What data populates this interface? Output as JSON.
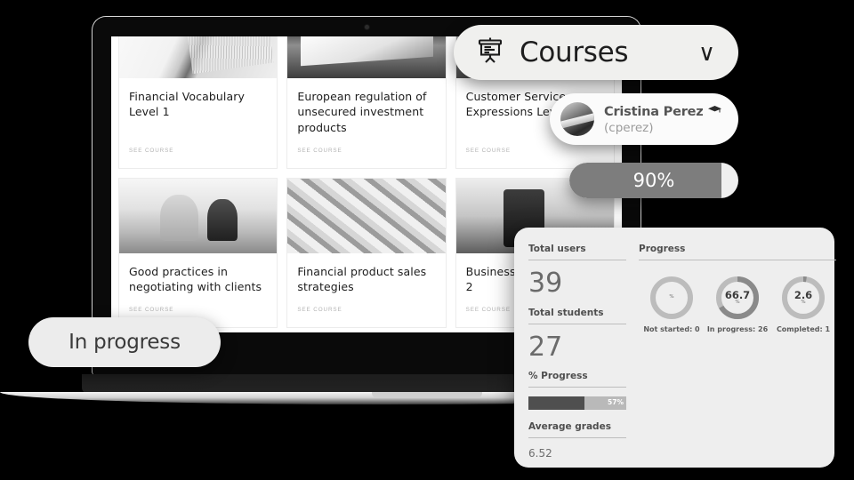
{
  "header": {
    "courses_label": "Courses",
    "chevron": "∨"
  },
  "user": {
    "name": "Cristina Perez",
    "handle": "(cperez)"
  },
  "progress_pill": {
    "value_label": "90%",
    "percent": 90
  },
  "status_pill": {
    "label": "In progress"
  },
  "courses": [
    {
      "title": "Financial Vocabulary Level 1",
      "link": "SEE COURSE",
      "photo": "ph-book"
    },
    {
      "title": "European regulation of unsecured investment products",
      "link": "SEE COURSE",
      "photo": "ph-sign"
    },
    {
      "title": "Customer Service Expressions Level 3",
      "link": "SEE COURSE",
      "photo": "ph-store"
    },
    {
      "title": "Good practices in negotiating with clients",
      "link": "SEE COURSE",
      "photo": "ph-meet"
    },
    {
      "title": "Financial product sales strategies",
      "link": "SEE COURSE",
      "photo": "ph-money"
    },
    {
      "title": "Business English Level 2",
      "link": "SEE COURSE",
      "photo": "ph-shop"
    }
  ],
  "panel": {
    "total_users_label": "Total users",
    "total_users_value": "39",
    "total_students_label": "Total students",
    "total_students_value": "27",
    "pct_progress_label": "% Progress",
    "pct_progress_value": "57%",
    "pct_progress_percent": 57,
    "average_grades_label": "Average grades",
    "average_grades_value": "6.52",
    "progress_label": "Progress"
  },
  "chart_data": {
    "type": "pie",
    "title": "Progress",
    "legend_position": "below",
    "series": [
      {
        "name": "Not started",
        "value": 0.0,
        "unit": "%",
        "display": "",
        "sub_label": "Not started: 0",
        "count": 0
      },
      {
        "name": "In progress",
        "value": 66.7,
        "unit": "%",
        "display": "66.7",
        "sub_label": "In progress: 26",
        "count": 26
      },
      {
        "name": "Completed",
        "value": 2.6,
        "unit": "%",
        "display": "2.6",
        "sub_label": "Completed: 1",
        "count": 1
      }
    ],
    "secondary": [
      {
        "name": "Total users",
        "value": 39
      },
      {
        "name": "Total students",
        "value": 27
      },
      {
        "name": "% Progress",
        "value": 57,
        "unit": "%"
      },
      {
        "name": "Average grades",
        "value": 6.52
      }
    ]
  },
  "donut_labels": {
    "pct_symbol": "%",
    "not_started": "Not started: 0",
    "in_progress": "In progress: 26",
    "completed": "Completed: 1"
  },
  "colors": {
    "track": "#bcbcbc",
    "arc": "#8a8a8a",
    "panel_bg": "#eeeeee",
    "pill_bg": "#f0f0ee"
  }
}
